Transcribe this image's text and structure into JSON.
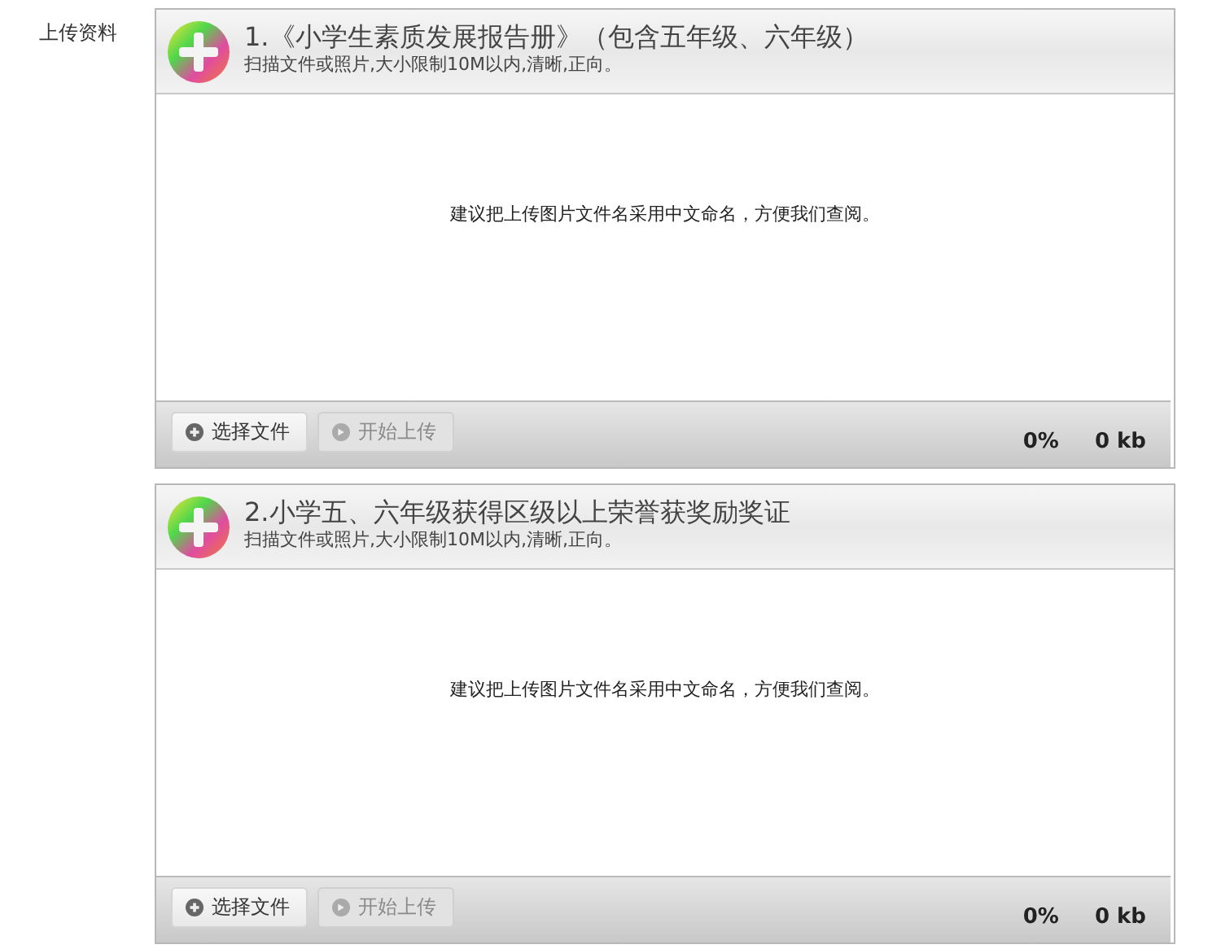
{
  "field_label": "上传资料",
  "uploaders": [
    {
      "title": "1.《小学生素质发展报告册》（包含五年级、六年级）",
      "subtitle": "扫描文件或照片,大小限制10M以内,清晰,正向。",
      "hint": "建议把上传图片文件名采用中文命名，方便我们查阅。",
      "choose_button": {
        "label": "选择文件",
        "disabled": false
      },
      "upload_button": {
        "label": "开始上传",
        "disabled": true
      },
      "percent": "0%",
      "size": "0 kb"
    },
    {
      "title": "2.小学五、六年级获得区级以上荣誉获奖励奖证",
      "subtitle": "扫描文件或照片,大小限制10M以内,清晰,正向。",
      "hint": "建议把上传图片文件名采用中文命名，方便我们查阅。",
      "choose_button": {
        "label": "选择文件",
        "disabled": false
      },
      "upload_button": {
        "label": "开始上传",
        "disabled": true
      },
      "percent": "0%",
      "size": "0 kb"
    }
  ]
}
